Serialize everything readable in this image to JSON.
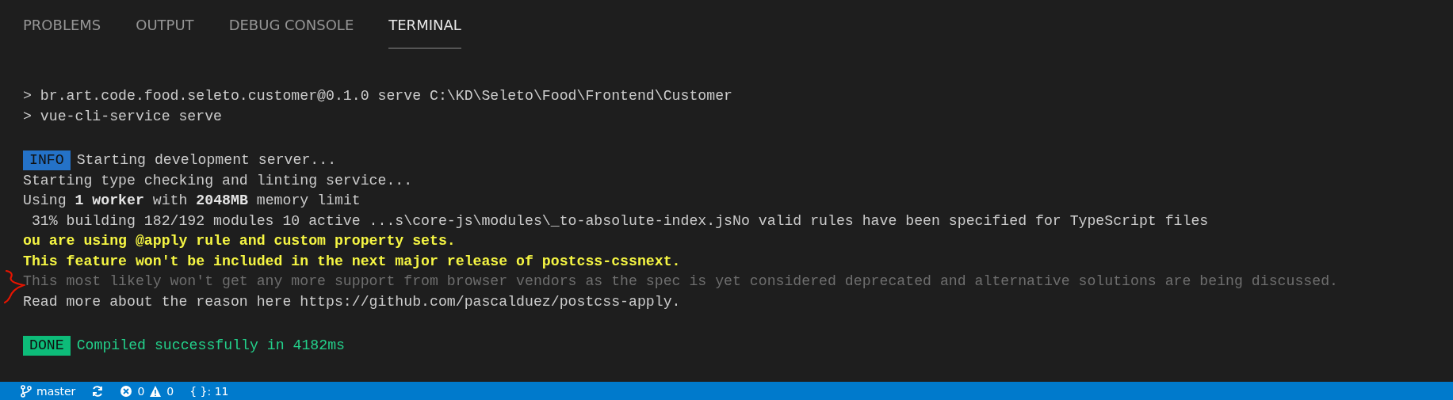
{
  "tabs": [
    {
      "label": "PROBLEMS",
      "selected": false
    },
    {
      "label": "OUTPUT",
      "selected": false
    },
    {
      "label": "DEBUG CONSOLE",
      "selected": false
    },
    {
      "label": "TERMINAL",
      "selected": true
    }
  ],
  "terminal": {
    "lines": [
      {
        "kind": "plain",
        "text": "> br.art.code.food.seleto.customer@0.1.0 serve C:\\KD\\Seleto\\Food\\Frontend\\Customer"
      },
      {
        "kind": "plain",
        "text": "> vue-cli-service serve"
      },
      {
        "kind": "blank"
      },
      {
        "kind": "info",
        "badge": "INFO",
        "text": "Starting development server..."
      },
      {
        "kind": "plain",
        "text": "Starting type checking and linting service..."
      },
      {
        "kind": "plain",
        "text": "Using **1 worker** with **2048MB** memory limit"
      },
      {
        "kind": "plain",
        "text": " 31% building 182/192 modules 10 active ...s\\core-js\\modules\\_to-absolute-index.jsNo valid rules have been specified for TypeScript files"
      },
      {
        "kind": "warning",
        "text": "ou are using @apply rule and custom property sets."
      },
      {
        "kind": "warning",
        "text": "This feature won't be included in the next major release of postcss-cssnext."
      },
      {
        "kind": "muted",
        "text": "This most likely won't get any more support from browser vendors as the spec is yet considered deprecated and alternative solutions are being discussed."
      },
      {
        "kind": "plain",
        "text": "Read more about the reason here https://github.com/pascalduez/postcss-apply."
      },
      {
        "kind": "blank"
      },
      {
        "kind": "done",
        "badge": "DONE",
        "text": "Compiled successfully in 4182ms"
      }
    ]
  },
  "status_bar": {
    "branch": "master",
    "errors": "0",
    "warnings": "0",
    "braces": "{ }: 11"
  }
}
